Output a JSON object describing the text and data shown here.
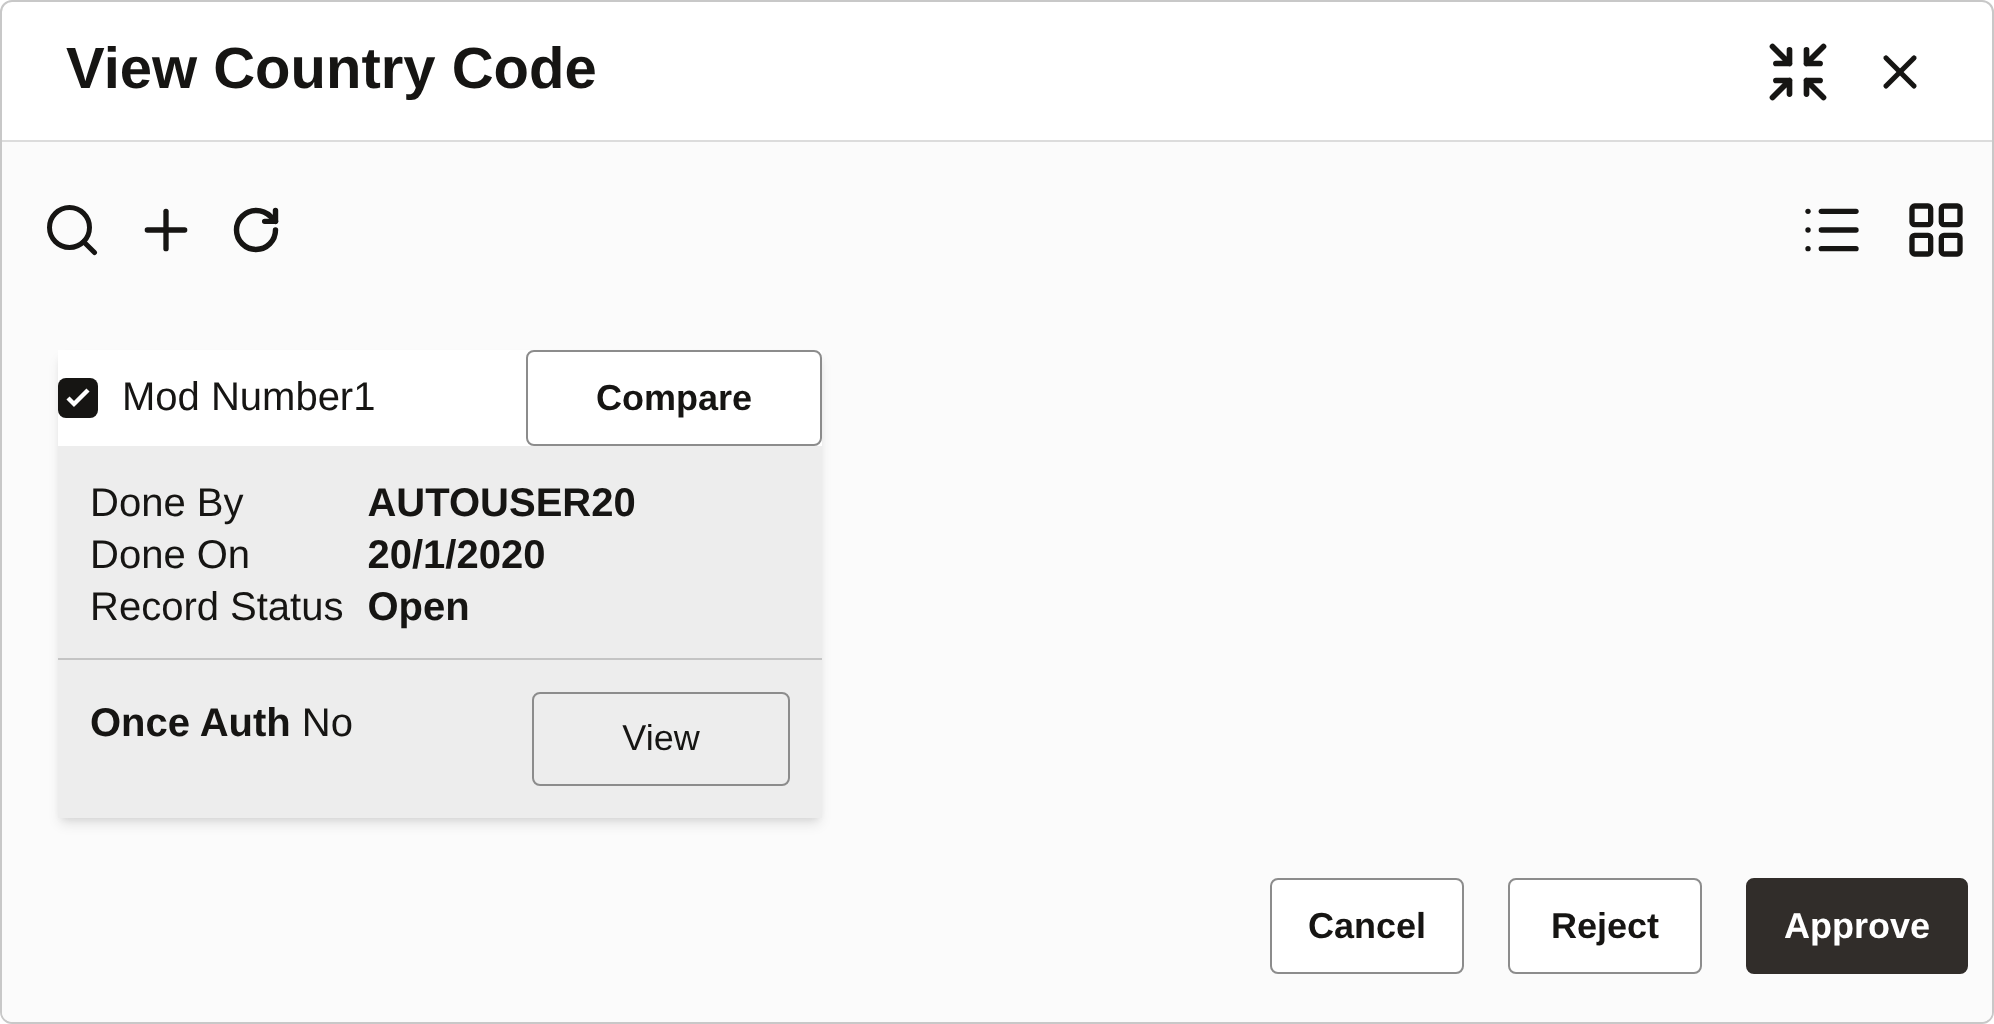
{
  "window": {
    "title": "View Country Code"
  },
  "card": {
    "checkbox": {
      "label": "Mod Number1",
      "checked": true
    },
    "compare_button": "Compare",
    "fields": [
      {
        "label": "Done By",
        "value": "AUTOUSER20"
      },
      {
        "label": "Done On",
        "value": "20/1/2020"
      },
      {
        "label": "Record Status",
        "value": "Open"
      }
    ],
    "once_auth": "**Once Auth** No",
    "view_button": "View"
  },
  "buttons": [
    {
      "label": "Cancel",
      "kind": "secondary"
    },
    {
      "label": "Reject",
      "kind": "secondary"
    },
    {
      "label": "Approve",
      "kind": "primary"
    }
  ]
}
